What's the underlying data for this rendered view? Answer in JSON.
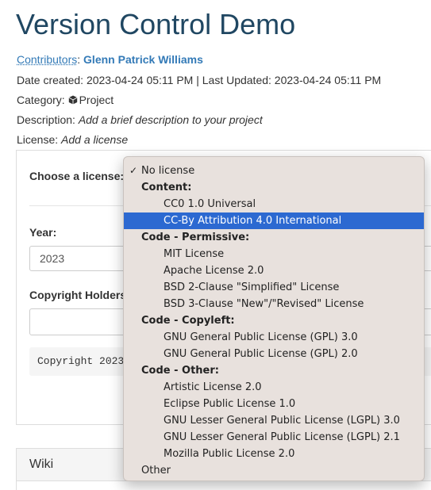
{
  "page": {
    "title": "Version Control Demo"
  },
  "meta": {
    "contributors_label": "Contributors",
    "contributors_sep": ": ",
    "contributor_name": "Glenn Patrick Williams",
    "dates": "Date created: 2023-04-24 05:11 PM | Last Updated: 2023-04-24 05:11 PM",
    "category_label": "Category: ",
    "category_value": "Project",
    "category_icon": "cube-icon",
    "description_label": "Description: ",
    "description_value": "Add a brief description to your project",
    "license_label": "License: ",
    "license_value": "Add a license"
  },
  "license_panel": {
    "choose_label": "Choose a license:",
    "year_label": "Year:",
    "year_value": "2023",
    "holders_label": "Copyright Holders",
    "holders_value": "",
    "copyright_preview": "Copyright 2023"
  },
  "wiki": {
    "title": "Wiki"
  },
  "dropdown": {
    "selected": "No license",
    "highlighted": "CC-By Attribution 4.0 International",
    "highlight_color": "#2c69d1",
    "items": [
      {
        "type": "top-option",
        "label": "No license"
      },
      {
        "type": "group",
        "label": "Content:"
      },
      {
        "type": "option",
        "label": "CC0 1.0 Universal"
      },
      {
        "type": "option",
        "label": "CC-By Attribution 4.0 International"
      },
      {
        "type": "group",
        "label": "Code - Permissive:"
      },
      {
        "type": "option",
        "label": "MIT License"
      },
      {
        "type": "option",
        "label": "Apache License 2.0"
      },
      {
        "type": "option",
        "label": "BSD 2-Clause \"Simplified\" License"
      },
      {
        "type": "option",
        "label": "BSD 3-Clause \"New\"/\"Revised\" License"
      },
      {
        "type": "group",
        "label": "Code - Copyleft:"
      },
      {
        "type": "option",
        "label": "GNU General Public License (GPL) 3.0"
      },
      {
        "type": "option",
        "label": "GNU General Public License (GPL) 2.0"
      },
      {
        "type": "group",
        "label": "Code - Other:"
      },
      {
        "type": "option",
        "label": "Artistic License 2.0"
      },
      {
        "type": "option",
        "label": "Eclipse Public License 1.0"
      },
      {
        "type": "option",
        "label": "GNU Lesser General Public License (LGPL) 3.0"
      },
      {
        "type": "option",
        "label": "GNU Lesser General Public License (LGPL) 2.1"
      },
      {
        "type": "option",
        "label": "Mozilla Public License 2.0"
      },
      {
        "type": "top-option",
        "label": "Other"
      }
    ]
  }
}
